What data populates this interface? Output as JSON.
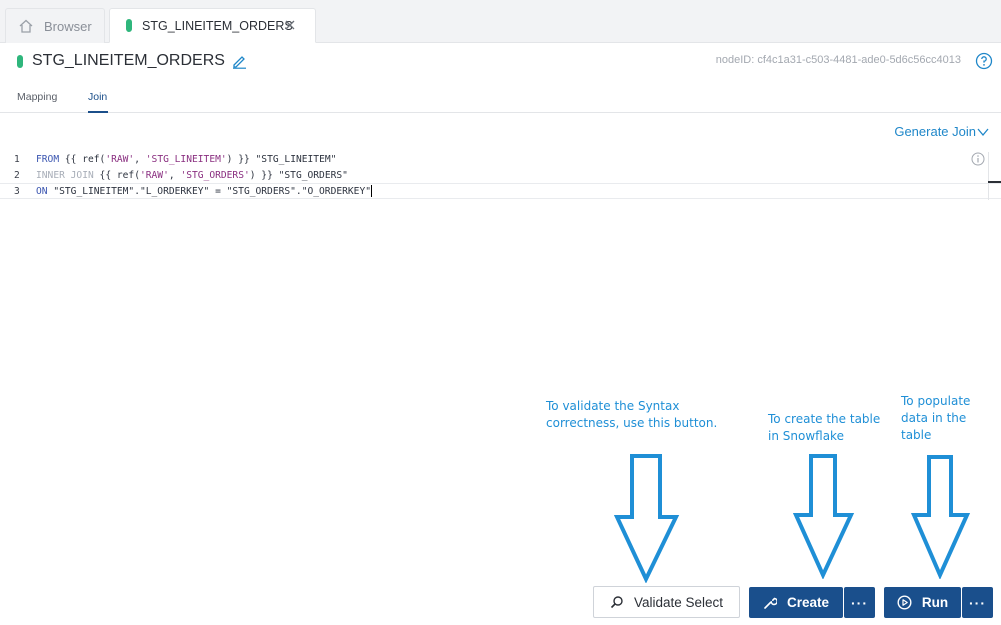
{
  "tabs": {
    "browser_label": "Browser",
    "active_label": "STG_LINEITEM_ORDERS"
  },
  "header": {
    "title": "STG_LINEITEM_ORDERS",
    "node_id": "nodeID: cf4c1a31-c503-4481-ade0-5d6c56cc4013"
  },
  "subtabs": {
    "mapping": "Mapping",
    "join": "Join"
  },
  "generate_join": "Generate Join",
  "editor": {
    "line_numbers": [
      "1",
      "2",
      "3"
    ],
    "lines": [
      "FROM {{ ref('RAW', 'STG_LINEITEM') }} \"STG_LINEITEM\"",
      "INNER JOIN {{ ref('RAW', 'STG_ORDERS') }} \"STG_ORDERS\"",
      "ON \"STG_LINEITEM\".\"L_ORDERKEY\" = \"STG_ORDERS\".\"O_ORDERKEY\""
    ]
  },
  "annotations": {
    "validate": "To validate the Syntax\ncorrectness, use this button.",
    "create": "To create the table\nin Snowflake",
    "run": "To populate\ndata in the\ntable"
  },
  "buttons": {
    "validate": "Validate Select",
    "create": "Create",
    "run": "Run",
    "more": "···"
  },
  "colors": {
    "primary": "#1a4f8c",
    "accent_green": "#2fb67c",
    "annotation_blue": "#1f8fd6",
    "link_blue": "#1f87c9"
  }
}
